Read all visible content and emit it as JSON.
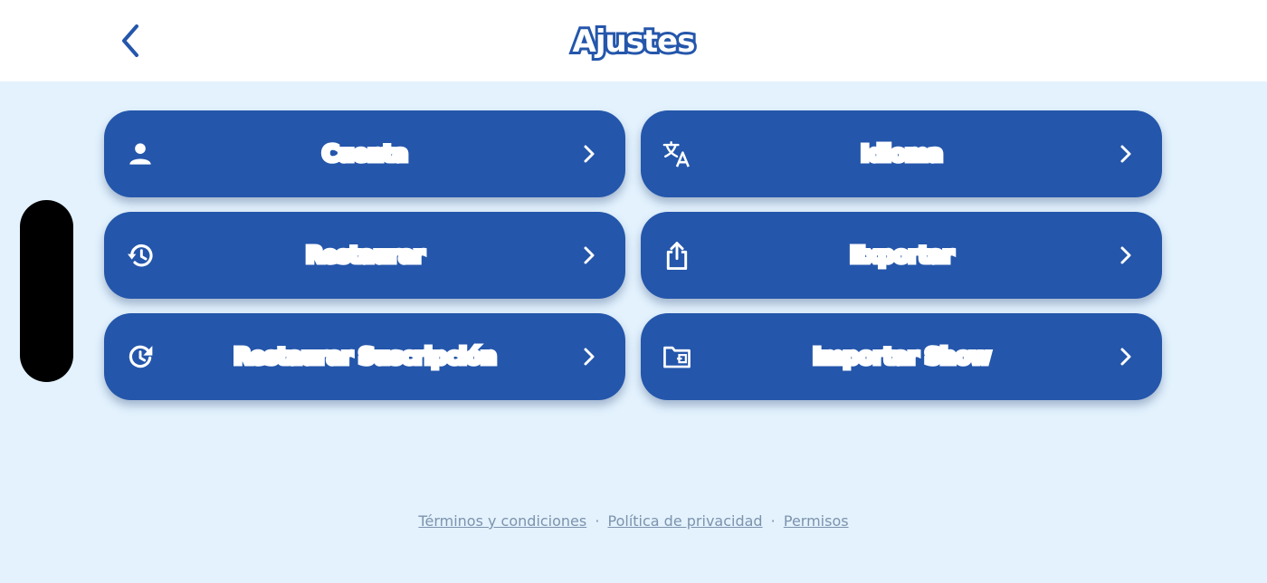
{
  "header": {
    "title": "Ajustes",
    "back_icon": "chevron-left-icon"
  },
  "colors": {
    "background": "#e3f2fd",
    "header": "#ffffff",
    "button": "#2456ab",
    "text_on_button": "#ffffff",
    "footer_link": "#7d93ad"
  },
  "menu": {
    "items": [
      {
        "label": "Cuenta",
        "icon": "person-icon"
      },
      {
        "label": "Idioma",
        "icon": "translate-icon"
      },
      {
        "label": "Restaurar",
        "icon": "history-icon"
      },
      {
        "label": "Exportar",
        "icon": "share-icon"
      },
      {
        "label": "Restaurar Suscripción",
        "icon": "refresh-icon"
      },
      {
        "label": "Importar Show",
        "icon": "folder-import-icon"
      }
    ]
  },
  "footer": {
    "terms": "Términos y condiciones",
    "privacy": "Política de privacidad",
    "permissions": "Permisos",
    "separator": "·"
  }
}
